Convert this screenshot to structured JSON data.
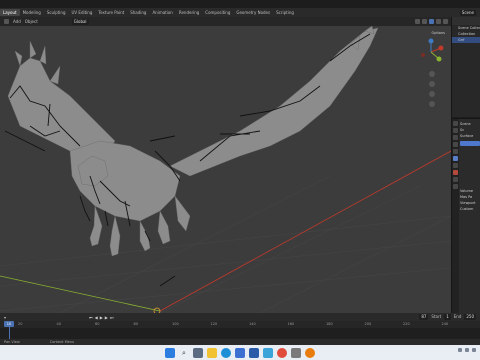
{
  "topbar": {
    "tabs": [
      "Layout",
      "Modeling",
      "Sculpting",
      "UV Editing",
      "Texture Paint",
      "Shading",
      "Animation",
      "Rendering",
      "Compositing",
      "Geometry Nodes",
      "Scripting"
    ],
    "active_tab": "Layout",
    "scene_label": "Scene"
  },
  "viewport_header": {
    "menus": [
      "Add",
      "Object"
    ],
    "transform_orientation": "Global"
  },
  "gizmo": {
    "options_label": "Options",
    "axis_x": "X",
    "axis_y": "Y",
    "axis_z": "Z"
  },
  "outliner": {
    "rows": [
      "Scene Collection",
      "Collection",
      "Grif"
    ]
  },
  "properties": {
    "rows": [
      "Scene",
      "Sc",
      "Surface",
      "Volume",
      "Mas Pa",
      "Viewport",
      "Custom"
    ]
  },
  "timeline": {
    "ticks": [
      "20",
      "40",
      "60",
      "80",
      "100",
      "120",
      "140",
      "160",
      "180",
      "200",
      "220",
      "240"
    ],
    "current_frame": "10",
    "frame_display": "87",
    "start_label": "Start",
    "start_value": "1",
    "end_label": "End",
    "end_value": "250"
  },
  "statusbar": {
    "left": "Pan View",
    "middle": "Context Menu"
  },
  "taskbar": {
    "icons": [
      "windows-logo",
      "search",
      "task-view",
      "folder",
      "edge",
      "store",
      "mail",
      "photos",
      "chrome",
      "settings",
      "blender"
    ]
  },
  "colors": {
    "accent": "#4b73b3",
    "viewport_bg": "#3c3c3c",
    "x_axis": "#c0392b",
    "y_axis": "#8bb230"
  }
}
